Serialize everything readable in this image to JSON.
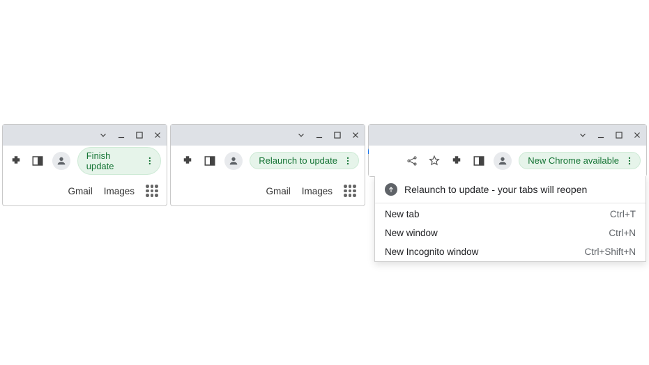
{
  "window_controls": {
    "minimize": "minimize",
    "maximize": "maximize",
    "close": "close"
  },
  "panel1": {
    "pill_label": "Finish update",
    "ntp": {
      "gmail": "Gmail",
      "images": "Images"
    }
  },
  "panel2": {
    "pill_label": "Relaunch to update",
    "ntp": {
      "gmail": "Gmail",
      "images": "Images"
    }
  },
  "panel3": {
    "pill_label": "New Chrome available",
    "menu": {
      "relaunch_header": "Relaunch to update - your tabs will reopen",
      "items": [
        {
          "label": "New tab",
          "hotkey": "Ctrl+T"
        },
        {
          "label": "New window",
          "hotkey": "Ctrl+N"
        },
        {
          "label": "New Incognito window",
          "hotkey": "Ctrl+Shift+N"
        }
      ]
    }
  }
}
